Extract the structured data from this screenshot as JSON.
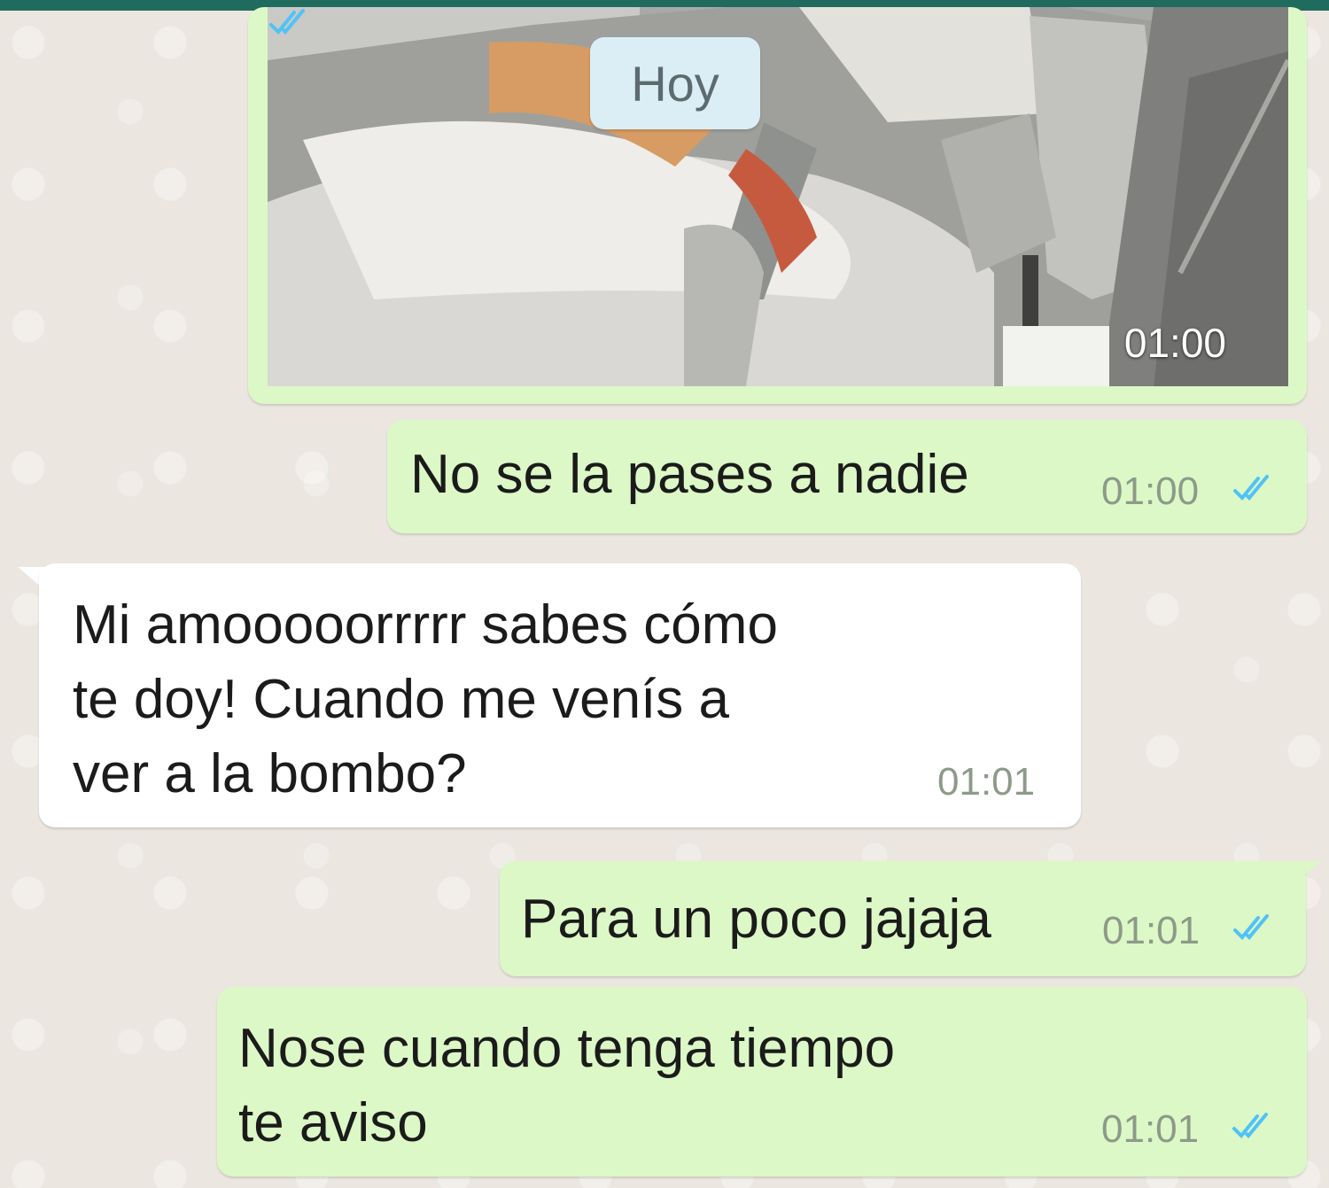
{
  "date_separator": "Hoy",
  "messages": [
    {
      "kind": "image",
      "direction": "outgoing",
      "time": "01:00",
      "status": "read"
    },
    {
      "kind": "text",
      "direction": "outgoing",
      "text": "No se la pases a nadie",
      "time": "01:00",
      "status": "read"
    },
    {
      "kind": "text",
      "direction": "incoming",
      "text": "Mi amooooorrrrr sabes cómo\nte doy! Cuando me venís a\nver a la bombo?",
      "time": "01:01"
    },
    {
      "kind": "text",
      "direction": "outgoing",
      "text": "Para un poco jajaja",
      "time": "01:01",
      "status": "read"
    },
    {
      "kind": "text",
      "direction": "outgoing",
      "text": "Nose cuando tenga tiempo\nte aviso",
      "time": "01:01",
      "status": "read"
    }
  ],
  "colors": {
    "outgoing_bubble": "#dcf8c6",
    "incoming_bubble": "#ffffff",
    "read_ticks": "#4fc3f7",
    "header": "#1f6b5d"
  },
  "icons": {
    "read_receipt": "double-check-icon"
  }
}
